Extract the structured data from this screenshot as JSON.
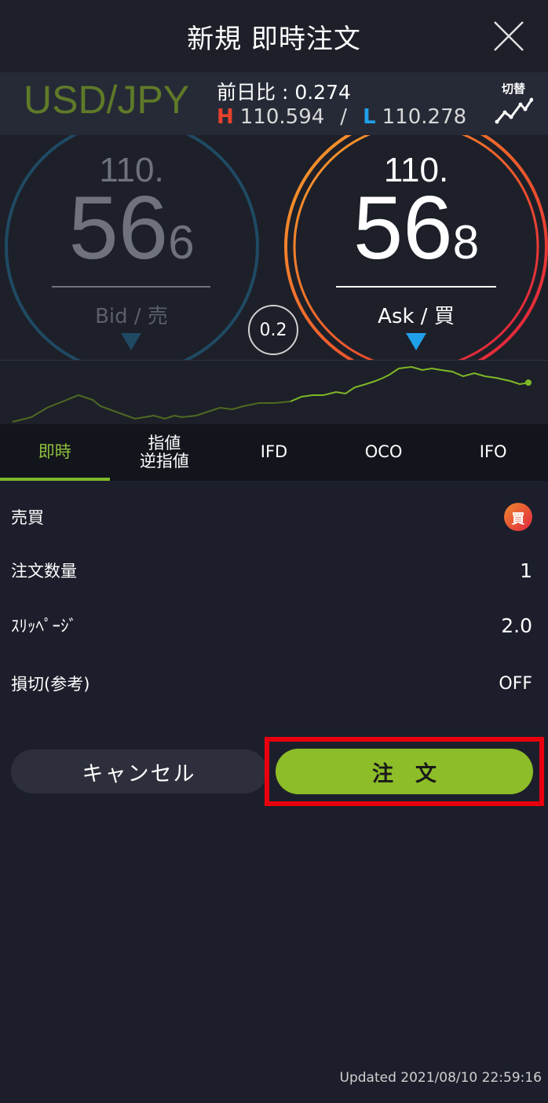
{
  "header": {
    "title": "新規 即時注文",
    "close_icon": "close-icon"
  },
  "pair": {
    "name": "USD/JPY",
    "prev_diff": "前日比 : 0.274",
    "high_mark": "H",
    "high_value": "110.594",
    "separator": "/",
    "low_mark": "L",
    "low_value": "110.278",
    "switch_label": "切替",
    "switch_icon": "trend-chart-icon"
  },
  "bid": {
    "top": "110.",
    "big": "56",
    "small": "6",
    "caption": "Bid / 売"
  },
  "ask": {
    "top": "110.",
    "big": "56",
    "small": "8",
    "caption": "Ask / 買"
  },
  "spread": "0.2",
  "colors": {
    "accent_green": "#8dbd28",
    "bid_ring": "#1f4a63",
    "ask_ring_start": "#f2962c",
    "ask_ring_end": "#e0193e",
    "high_red": "#e8412c",
    "low_blue": "#21a0ea",
    "highlight_red": "#e8000e"
  },
  "tabs": [
    {
      "label": "即時",
      "active": true
    },
    {
      "label": "指値\n逆指値",
      "active": false
    },
    {
      "label": "IFD",
      "active": false
    },
    {
      "label": "OCO",
      "active": false
    },
    {
      "label": "IFO",
      "active": false
    }
  ],
  "form": {
    "side_label": "売買",
    "side_value": "買",
    "quantity_label": "注文数量",
    "quantity_value": "1",
    "slippage_label": "ｽﾘｯﾍﾟｰｼﾞ",
    "slippage_value": "2.0",
    "stoploss_label": "損切(参考)",
    "stoploss_value": "OFF"
  },
  "buttons": {
    "cancel": "キャンセル",
    "order": "注文"
  },
  "updated": "Updated  2021/08/10 22:59:16"
}
